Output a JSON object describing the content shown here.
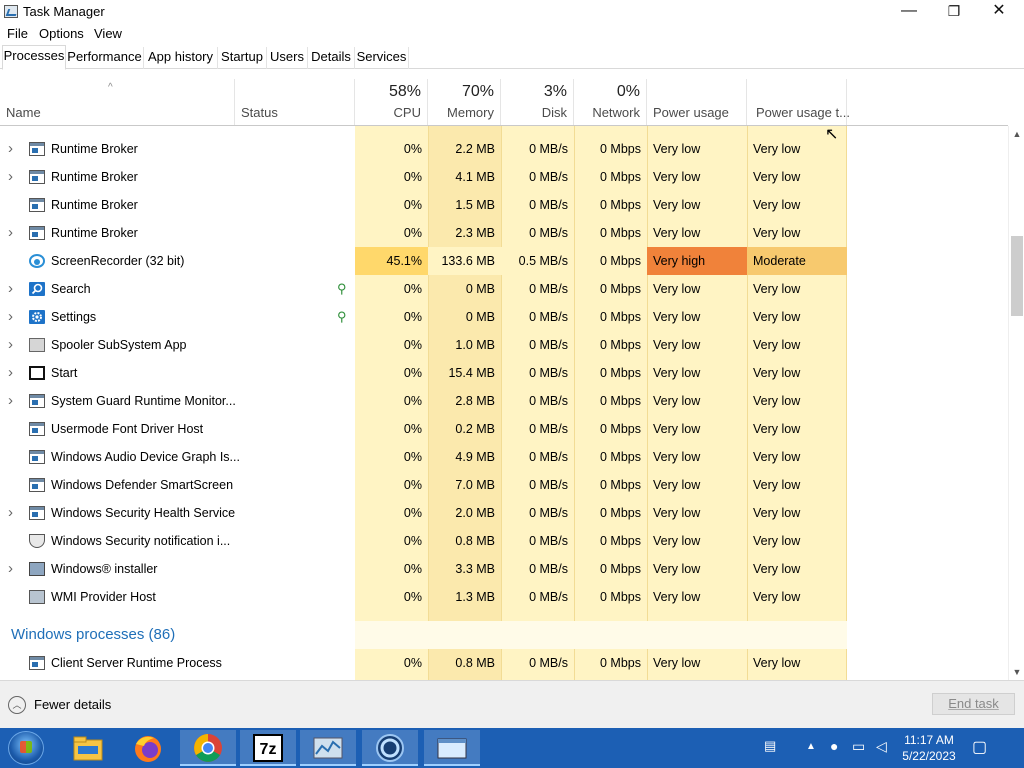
{
  "window": {
    "title": "Task Manager",
    "minimize": "—",
    "maximize": "❐",
    "close": "✕"
  },
  "menu": [
    "File",
    "Options",
    "View"
  ],
  "tabs": [
    "Processes",
    "Performance",
    "App history",
    "Startup",
    "Users",
    "Details",
    "Services"
  ],
  "columns": {
    "name": "Name",
    "status": "Status",
    "cpu": {
      "pct": "58%",
      "label": "CPU"
    },
    "memory": {
      "pct": "70%",
      "label": "Memory"
    },
    "disk": {
      "pct": "3%",
      "label": "Disk"
    },
    "network": {
      "pct": "0%",
      "label": "Network"
    },
    "power": "Power usage",
    "power_trend": "Power usage t..."
  },
  "colors": {
    "cpu_low": "#fff4c4",
    "mem_low": "#fbe9ad",
    "cpu_high": "#ffd86b",
    "power_very_high": "#f0823a",
    "power_moderate": "#f7c96e",
    "accent": "#1f6fb8"
  },
  "rows": [
    {
      "name": "Runtime Broker",
      "icon": "window-icon",
      "expand": true,
      "cpu": "0%",
      "memory": "2.2 MB",
      "disk": "0 MB/s",
      "network": "0 Mbps",
      "power": "Very low",
      "trend": "Very low"
    },
    {
      "name": "Runtime Broker",
      "icon": "window-icon",
      "expand": true,
      "cpu": "0%",
      "memory": "4.1 MB",
      "disk": "0 MB/s",
      "network": "0 Mbps",
      "power": "Very low",
      "trend": "Very low"
    },
    {
      "name": "Runtime Broker",
      "icon": "window-icon",
      "expand": false,
      "cpu": "0%",
      "memory": "1.5 MB",
      "disk": "0 MB/s",
      "network": "0 Mbps",
      "power": "Very low",
      "trend": "Very low"
    },
    {
      "name": "Runtime Broker",
      "icon": "window-icon",
      "expand": true,
      "cpu": "0%",
      "memory": "2.3 MB",
      "disk": "0 MB/s",
      "network": "0 Mbps",
      "power": "Very low",
      "trend": "Very low"
    },
    {
      "name": "ScreenRecorder (32 bit)",
      "icon": "record-icon",
      "expand": false,
      "cpu": "45.1%",
      "memory": "133.6 MB",
      "disk": "0.5 MB/s",
      "network": "0 Mbps",
      "power": "Very high",
      "trend": "Moderate",
      "hot": true
    },
    {
      "name": "Search",
      "icon": "search-icon",
      "expand": true,
      "cpu": "0%",
      "memory": "0 MB",
      "disk": "0 MB/s",
      "network": "0 Mbps",
      "power": "Very low",
      "trend": "Very low",
      "suspended": true
    },
    {
      "name": "Settings",
      "icon": "gear-icon",
      "expand": true,
      "cpu": "0%",
      "memory": "0 MB",
      "disk": "0 MB/s",
      "network": "0 Mbps",
      "power": "Very low",
      "trend": "Very low",
      "suspended": true
    },
    {
      "name": "Spooler SubSystem App",
      "icon": "printer-icon",
      "expand": true,
      "cpu": "0%",
      "memory": "1.0 MB",
      "disk": "0 MB/s",
      "network": "0 Mbps",
      "power": "Very low",
      "trend": "Very low"
    },
    {
      "name": "Start",
      "icon": "start-icon",
      "expand": true,
      "cpu": "0%",
      "memory": "15.4 MB",
      "disk": "0 MB/s",
      "network": "0 Mbps",
      "power": "Very low",
      "trend": "Very low"
    },
    {
      "name": "System Guard Runtime Monitor...",
      "icon": "window-icon",
      "expand": true,
      "cpu": "0%",
      "memory": "2.8 MB",
      "disk": "0 MB/s",
      "network": "0 Mbps",
      "power": "Very low",
      "trend": "Very low"
    },
    {
      "name": "Usermode Font Driver Host",
      "icon": "window-icon",
      "expand": false,
      "cpu": "0%",
      "memory": "0.2 MB",
      "disk": "0 MB/s",
      "network": "0 Mbps",
      "power": "Very low",
      "trend": "Very low"
    },
    {
      "name": "Windows Audio Device Graph Is...",
      "icon": "window-icon",
      "expand": false,
      "cpu": "0%",
      "memory": "4.9 MB",
      "disk": "0 MB/s",
      "network": "0 Mbps",
      "power": "Very low",
      "trend": "Very low"
    },
    {
      "name": "Windows Defender SmartScreen",
      "icon": "window-icon",
      "expand": false,
      "cpu": "0%",
      "memory": "7.0 MB",
      "disk": "0 MB/s",
      "network": "0 Mbps",
      "power": "Very low",
      "trend": "Very low"
    },
    {
      "name": "Windows Security Health Service",
      "icon": "window-icon",
      "expand": true,
      "cpu": "0%",
      "memory": "2.0 MB",
      "disk": "0 MB/s",
      "network": "0 Mbps",
      "power": "Very low",
      "trend": "Very low"
    },
    {
      "name": "Windows Security notification i...",
      "icon": "shield-icon",
      "expand": false,
      "cpu": "0%",
      "memory": "0.8 MB",
      "disk": "0 MB/s",
      "network": "0 Mbps",
      "power": "Very low",
      "trend": "Very low"
    },
    {
      "name": "Windows® installer",
      "icon": "installer-icon",
      "expand": true,
      "cpu": "0%",
      "memory": "3.3 MB",
      "disk": "0 MB/s",
      "network": "0 Mbps",
      "power": "Very low",
      "trend": "Very low"
    },
    {
      "name": "WMI Provider Host",
      "icon": "wmi-icon",
      "expand": false,
      "cpu": "0%",
      "memory": "1.3 MB",
      "disk": "0 MB/s",
      "network": "0 Mbps",
      "power": "Very low",
      "trend": "Very low"
    }
  ],
  "group": {
    "title": "Windows processes (86)"
  },
  "group_rows": [
    {
      "name": "Client Server Runtime Process",
      "icon": "window-icon",
      "expand": false,
      "cpu": "0%",
      "memory": "0.8 MB",
      "disk": "0 MB/s",
      "network": "0 Mbps",
      "power": "Very low",
      "trend": "Very low"
    }
  ],
  "footer": {
    "fewer_details": "Fewer details",
    "end_task": "End task"
  },
  "taskbar": {
    "apps": [
      "file-explorer-icon",
      "firefox-icon",
      "chrome-icon",
      "7zip-icon",
      "task-manager-icon",
      "screen-recorder-icon",
      "app-window-icon"
    ],
    "seven_zip_label": "7z",
    "time": "11:17 AM",
    "date": "5/22/2023"
  }
}
